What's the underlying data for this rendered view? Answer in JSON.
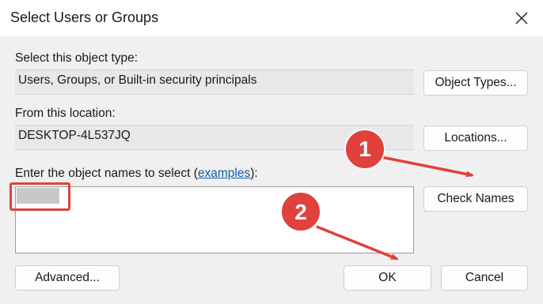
{
  "window": {
    "title": "Select Users or Groups"
  },
  "object_type": {
    "label": "Select this object type:",
    "value": "Users, Groups, or Built-in security principals",
    "button": "Object Types..."
  },
  "location": {
    "label": "From this location:",
    "value": "DESKTOP-4L537JQ",
    "button": "Locations..."
  },
  "names": {
    "label_pre": "Enter the object names to select (",
    "link": "examples",
    "label_post": "):",
    "value": "",
    "check_button": "Check Names"
  },
  "footer": {
    "advanced": "Advanced...",
    "ok": "OK",
    "cancel": "Cancel"
  },
  "annotations": {
    "step1": "1",
    "step2": "2",
    "color": "#e0413c"
  },
  "icons": {
    "close": "close-icon"
  }
}
